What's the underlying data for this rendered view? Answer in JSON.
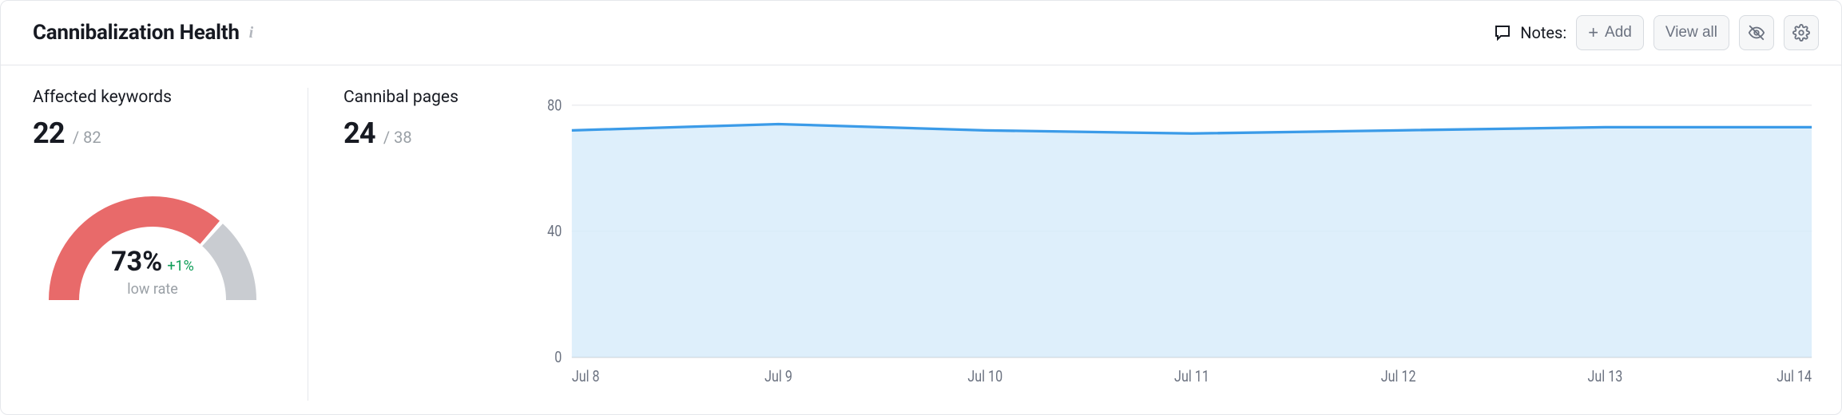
{
  "header": {
    "title": "Cannibalization Health",
    "notes_label": "Notes:",
    "add_label": "Add",
    "view_all_label": "View all"
  },
  "stats": {
    "affected": {
      "label": "Affected keywords",
      "value": "22",
      "total": "/ 82"
    },
    "cannibal": {
      "label": "Cannibal pages",
      "value": "24",
      "total": "/ 38"
    }
  },
  "gauge": {
    "percent_label": "73%",
    "delta_label": "+1%",
    "sub_label": "low rate",
    "fraction": 0.73
  },
  "chart_data": {
    "type": "area",
    "x": [
      "Jul 8",
      "Jul 9",
      "Jul 10",
      "Jul 11",
      "Jul 12",
      "Jul 13",
      "Jul 14"
    ],
    "values": [
      72,
      74,
      72,
      71,
      72,
      73,
      73
    ],
    "ylim": [
      0,
      80
    ],
    "yticks": [
      0,
      40,
      80
    ],
    "title": "",
    "xlabel": "",
    "ylabel": ""
  },
  "colors": {
    "gauge_fill": "#e86a6a",
    "gauge_track": "#c9ccd1",
    "line": "#3b9be8",
    "area": "#d8ecfa",
    "delta_pos": "#0f9d58"
  }
}
